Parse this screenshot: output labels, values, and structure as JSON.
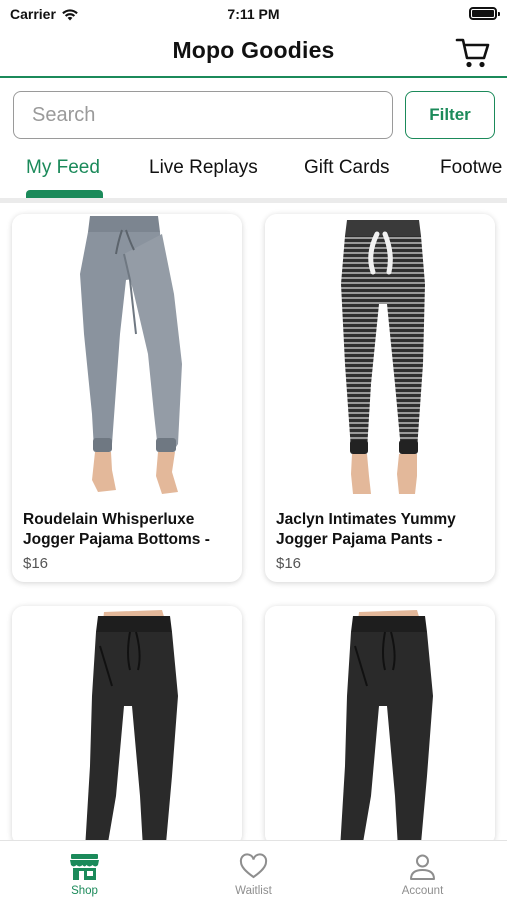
{
  "status_bar": {
    "carrier": "Carrier",
    "time": "7:11 PM"
  },
  "header": {
    "title": "Mopo Goodies",
    "cart_icon": "cart-icon"
  },
  "search": {
    "placeholder": "Search",
    "value": ""
  },
  "filter": {
    "label": "Filter"
  },
  "tabs": [
    {
      "label": "My Feed",
      "active": true
    },
    {
      "label": "Live Replays",
      "active": false
    },
    {
      "label": "Gift Cards",
      "active": false
    },
    {
      "label": "Footwe",
      "active": false
    }
  ],
  "products": [
    {
      "name": "Roudelain Whisperluxe Jogger Pajama Bottoms -",
      "price": "$16"
    },
    {
      "name": "Jaclyn Intimates Yummy Jogger Pajama Pants -",
      "price": "$16"
    },
    {
      "name": "",
      "price": ""
    },
    {
      "name": "",
      "price": ""
    }
  ],
  "tabbar": [
    {
      "label": "Shop",
      "icon": "storefront-icon",
      "active": true
    },
    {
      "label": "Waitlist",
      "icon": "heart-icon",
      "active": false
    },
    {
      "label": "Account",
      "icon": "person-icon",
      "active": false
    }
  ],
  "colors": {
    "brand": "#1b8a5a",
    "muted": "#8e8e8e"
  }
}
